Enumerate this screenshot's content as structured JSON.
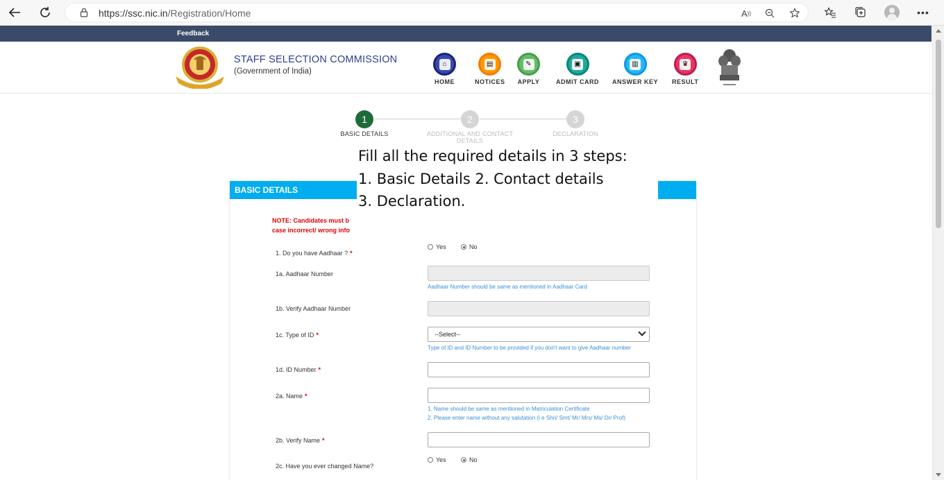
{
  "browser": {
    "url_host": "https://ssc.nic.in",
    "url_path": "/Registration/Home"
  },
  "topbar": {
    "feedback": "Feedback"
  },
  "org": {
    "title": "STAFF SELECTION COMMISSION",
    "subtitle": "(Government of India)"
  },
  "nav": [
    {
      "label": "HOME",
      "color": "#1a237e"
    },
    {
      "label": "NOTICES",
      "color": "#f57c00"
    },
    {
      "label": "APPLY",
      "color": "#43a047"
    },
    {
      "label": "ADMIT CARD",
      "color": "#00897b"
    },
    {
      "label": "ANSWER KEY",
      "color": "#039be5"
    },
    {
      "label": "RESULT",
      "color": "#c2185b"
    }
  ],
  "stepper": [
    {
      "num": "1",
      "label": "BASIC DETAILS",
      "active": true
    },
    {
      "num": "2",
      "label": "ADDITIONAL AND CONTACT DETAILS",
      "active": false
    },
    {
      "num": "3",
      "label": "DECLARATION",
      "active": false
    }
  ],
  "overlay": {
    "line1": "Fill all the required details in 3 steps:",
    "line2": "1. Basic Details 2. Contact details",
    "line3": "3. Declaration."
  },
  "form": {
    "header": "BASIC DETAILS",
    "note_line1": "NOTE: Candidates must b",
    "note_line2": "case incorrect/ wrong info",
    "q1_label": "1. Do you have Aadhaar ?",
    "yes": "Yes",
    "no": "No",
    "q1a_label": "1a. Aadhaar Number",
    "q1a_hint": "Aadhaar Number should be same as mentioned in Aadhaar Card",
    "q1b_label": "1b. Verify Aadhaar Number",
    "q1c_label": "1c. Type of ID",
    "q1c_value": "--Select--",
    "q1c_hint": "Type of ID and ID Number to be provided if you don't want to give Aadhaar number",
    "q1d_label": "1d. ID Number",
    "q2a_label": "2a. Name",
    "q2a_hint1": "1. Name should be same as mentioned in Matriculation Certificate",
    "q2a_hint2": "2. Please enter name without any salutation (i e Shri/ Smt/ Mr/ Mrs/ Ms/ Dr/ Prof)",
    "q2b_label": "2b. Verify Name",
    "q2c_label": "2c. Have you ever changed Name?",
    "asterisk": "*"
  },
  "colors": {
    "topbar": "#3a4a68",
    "card_header": "#00aeef",
    "step_active": "#1e6b3a",
    "step_inactive": "#d5d5d5",
    "required": "#e00000",
    "hint": "#3a8fd9"
  }
}
